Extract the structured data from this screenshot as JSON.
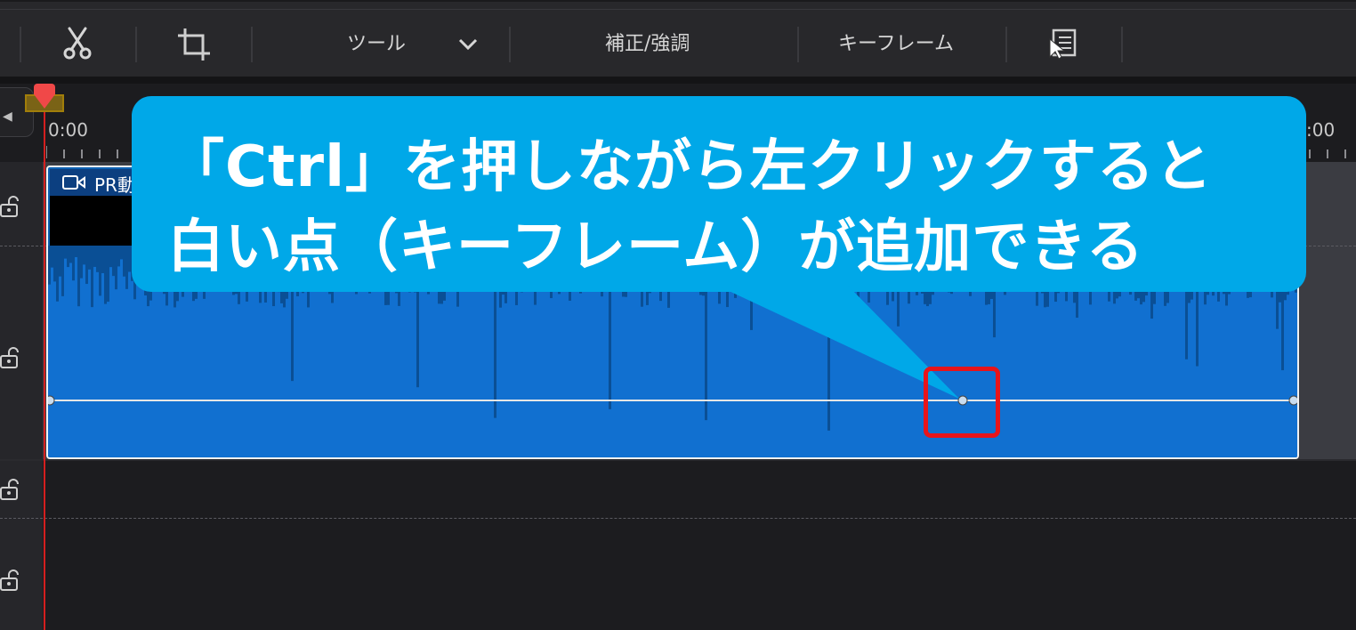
{
  "toolbar": {
    "tools_label": "ツール",
    "correction_label": "補正/強調",
    "keyframe_label": "キーフレーム",
    "icons": [
      "scissors-icon",
      "crop-icon",
      "chevron-down-icon",
      "list-icon"
    ]
  },
  "ruler": {
    "time_left": "0:00",
    "time_right": ":00"
  },
  "clip": {
    "title": "PR動",
    "colors": {
      "clip": "#0e62b4",
      "title_bar": "#0c3f80",
      "waveform_dark": "#0a4f95"
    }
  },
  "callout": {
    "line1": "「Ctrl」を押しながら左クリックすると",
    "line2": "白い点（キーフレーム）が追加できる",
    "color": "#00a8e8"
  },
  "highlight": {
    "color": "#e8141a"
  }
}
